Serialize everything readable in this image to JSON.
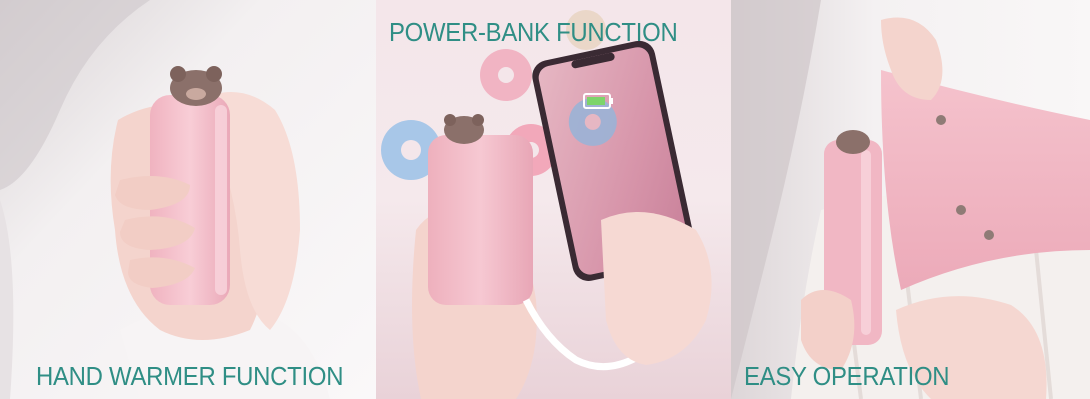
{
  "panels": [
    {
      "caption": "HAND WARMER FUNCTION"
    },
    {
      "caption": "POWER-BANK FUNCTION"
    },
    {
      "caption": "EASY OPERATION"
    }
  ],
  "colors": {
    "caption": "#2f8e85",
    "device_pink": "#f2b9c6",
    "skin": "#f6d8d2",
    "background": "#f4eff1"
  },
  "icons": [
    "bear-ear-topper",
    "phone-battery-icon",
    "usb-cable"
  ]
}
